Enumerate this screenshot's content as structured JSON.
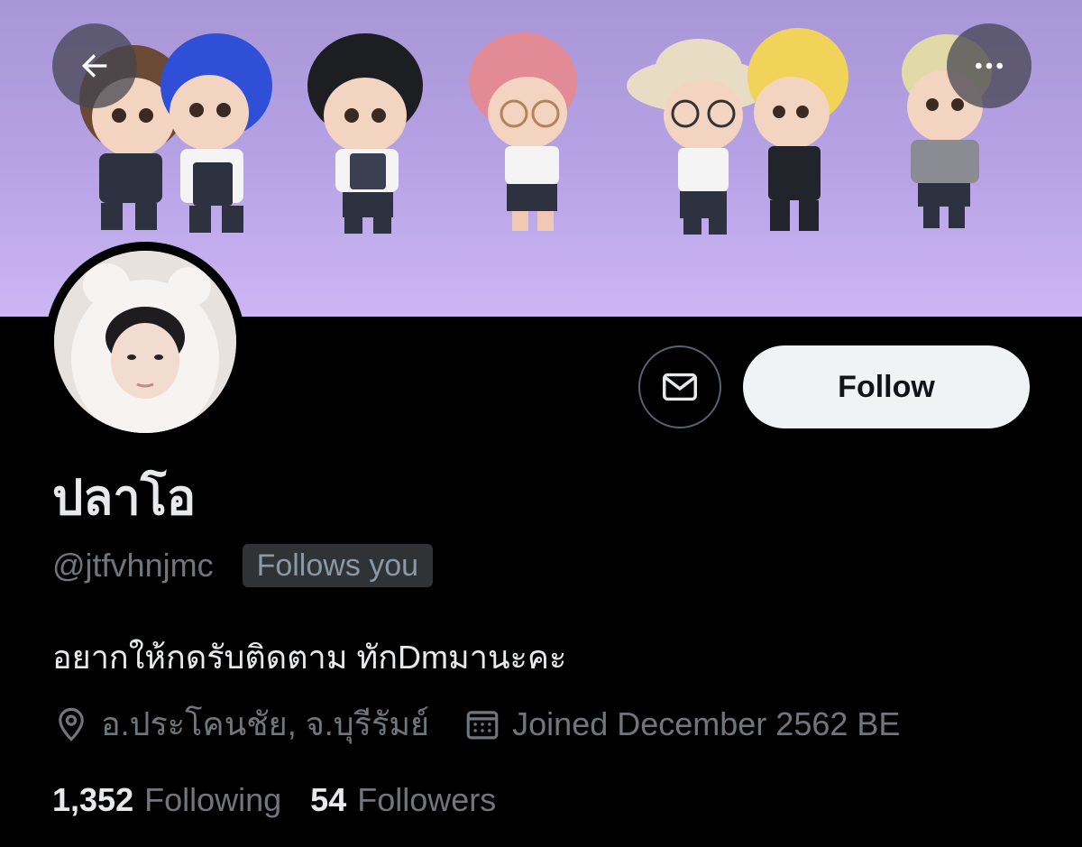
{
  "header": {
    "back_icon": "arrow-left-icon",
    "more_icon": "more-horizontal-icon"
  },
  "banner": {
    "description_icon": "chibi-characters-illustration"
  },
  "profile": {
    "display_name": "ปลาโอ",
    "handle": "@jtfvhnjmc",
    "follows_you": "Follows you",
    "bio": "อยากให้กดรับติดตาม ทักDmมานะคะ",
    "location": "อ.ประโคนชัย, จ.บุรีรัมย์",
    "joined": "Joined December 2562 BE"
  },
  "actions": {
    "message_icon": "envelope-icon",
    "follow_label": "Follow"
  },
  "stats": {
    "following_count": "1,352",
    "following_label": "Following",
    "followers_count": "54",
    "followers_label": "Followers"
  },
  "colors": {
    "background": "#000000",
    "primary_text": "#e7e9ea",
    "secondary_text": "#71767b",
    "follow_button_bg": "#eff3f4",
    "banner_purple": "#b7a3e6"
  }
}
